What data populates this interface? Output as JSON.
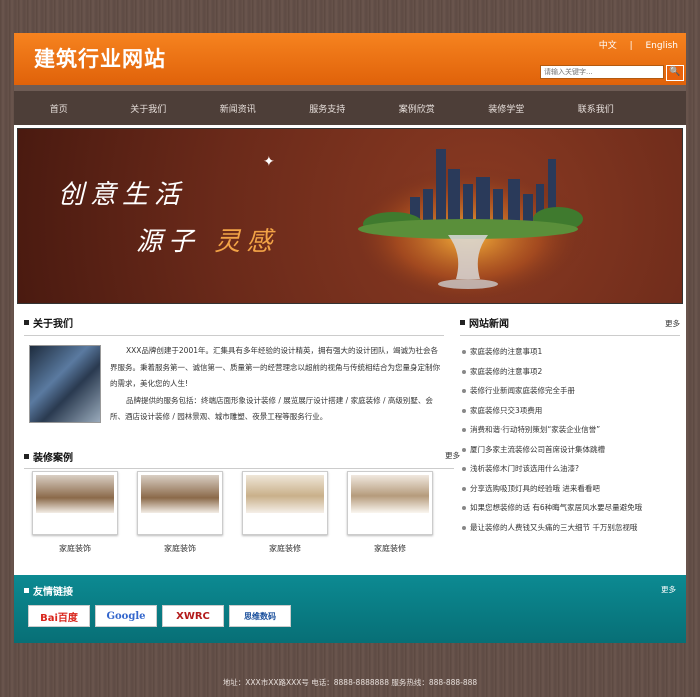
{
  "header": {
    "site_title": "建筑行业网站",
    "lang_cn": "中文",
    "lang_sep": "|",
    "lang_en": "English",
    "search_placeholder": "请输入关键字...",
    "search_button": "🔍"
  },
  "nav": [
    "首页",
    "关于我们",
    "新闻资讯",
    "服务支持",
    "案例欣赏",
    "装修学堂",
    "联系我们"
  ],
  "banner": {
    "slogan1": "创意生活",
    "slogan2_a": "源子",
    "slogan2_b": "灵感"
  },
  "about": {
    "title": "关于我们",
    "p1": "XXX品牌创建于2001年。汇集具有多年经验的设计精英，拥有强大的设计团队，竭诚为社会各界服务。秉着服务第一、诚信第一、质量第一的经营理念以超前的视角与传统相结合为您量身定制你的需求，美化您的人生!",
    "p2": "品牌提供的服务包括：终端店面形象设计装修 / 展览展厅设计搭建 / 家庭装修 / 高级别墅、会所、酒店设计装修 / 园林景观、城市雕塑、夜景工程等服务行业。"
  },
  "cases": {
    "title": "装修案例",
    "more": "更多",
    "items": [
      "家庭装饰",
      "家庭装饰",
      "家庭装修",
      "家庭装修"
    ]
  },
  "news": {
    "title": "网站新闻",
    "more": "更多",
    "items": [
      "家庭装修的注意事项1",
      "家庭装修的注意事项2",
      "装修行业新闻家庭装修完全手册",
      "家庭装修只交3项费用",
      "消费和谐·行动特别策划“家装企业信誉”",
      "厦门多家主流装修公司首席设计集体跳槽",
      "浅析装修木门时该选用什么油漆?",
      "分享选购吸顶灯具的经验哦 进来看看吧",
      "如果您想装修的话 有6种晦气家居风水要尽量避免哦",
      "最让装修的人费钱又头痛的三大细节 千万别忽视哦"
    ]
  },
  "links": {
    "title": "友情链接",
    "more": "更多",
    "logos": [
      "Bai百度",
      "Google",
      "XWRC",
      "思维数码"
    ]
  },
  "footer": "地址：XXX市XX路XXX号 电话：8888-8888888 服务热线：888-888-888"
}
